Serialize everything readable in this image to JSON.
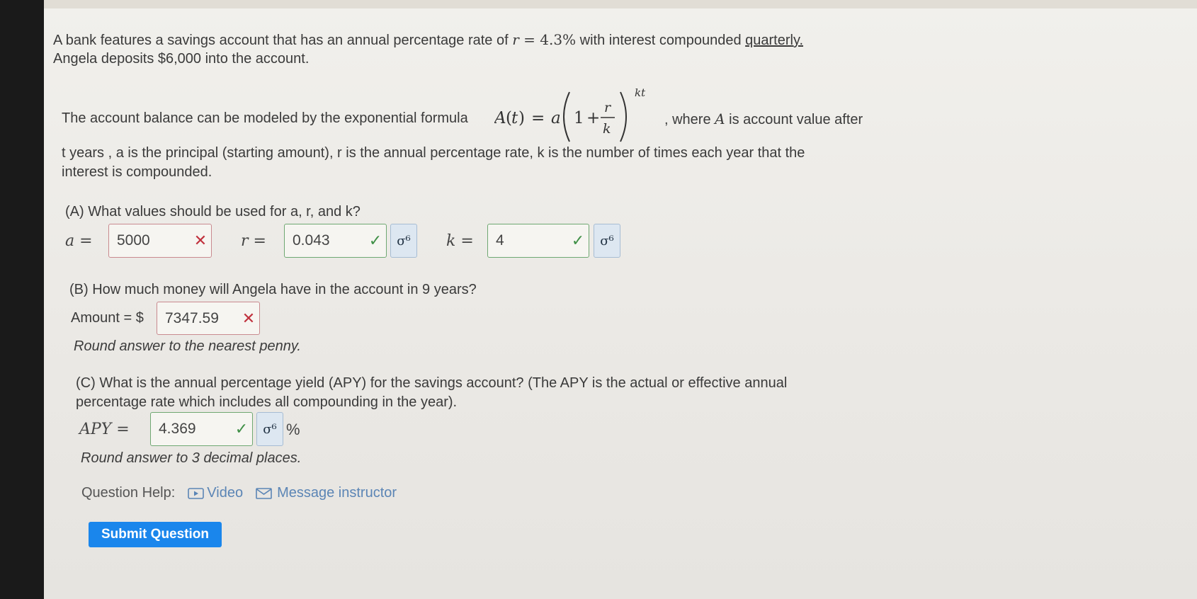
{
  "problem": {
    "intro_line1_a": "A bank features a savings account that has an annual percentage rate of ",
    "intro_r": "r",
    "intro_eq": " = 4.3%",
    "intro_line1_b": " with interest compounded ",
    "intro_quarterly": "quarterly.",
    "intro_line2": "Angela deposits $6,000 into the account.",
    "formula_lead": "The account balance can be modeled by the exponential formula ",
    "formula_after": ", where ",
    "formula_A": "A",
    "formula_after2": " is account value after",
    "desc_line2": "t years , a is the principal (starting amount), r is the annual percentage rate, k is the number of times each year that the",
    "desc_line3": "interest is compounded."
  },
  "part_a": {
    "question": "(A) What values should be used for a, r, and k?",
    "a_label": "a =",
    "a_value": "5000",
    "r_label": "r =",
    "r_value": "0.043",
    "k_label": "k =",
    "k_value": "4"
  },
  "part_b": {
    "question": "(B) How much money will Angela have in the account in 9 years?",
    "amount_label": "Amount = $",
    "amount_value": "7347.59",
    "note": "Round answer to the nearest penny."
  },
  "part_c": {
    "question_line1": "(C) What is the annual percentage yield (APY) for the savings account? (The APY is the actual or effective annual",
    "question_line2": "percentage rate which includes all compounding in the year).",
    "apy_label": "APY =",
    "apy_value": "4.369",
    "percent": "%",
    "note": "Round answer to 3 decimal places."
  },
  "help": {
    "label": "Question Help:",
    "video": "Video",
    "message": "Message instructor"
  },
  "submit_label": "Submit Question",
  "icons": {
    "wrong": "✕",
    "correct": "✓",
    "key": "σ⁶"
  }
}
